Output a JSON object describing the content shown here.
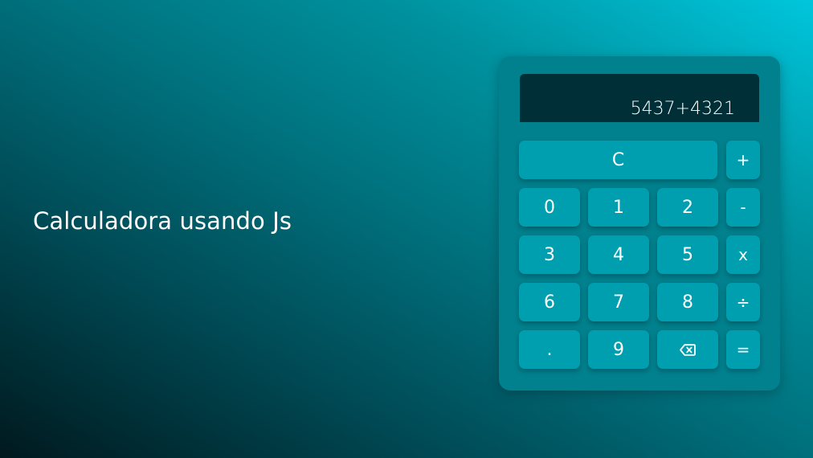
{
  "page": {
    "title": "Calculadora usando Js"
  },
  "calculator": {
    "display": "5437+4321",
    "keys": {
      "clear": "C",
      "plus": "+",
      "minus": "-",
      "multiply": "x",
      "divide": "÷",
      "equals": "=",
      "decimal": ".",
      "digit_0": "0",
      "digit_1": "1",
      "digit_2": "2",
      "digit_3": "3",
      "digit_4": "4",
      "digit_5": "5",
      "digit_6": "6",
      "digit_7": "7",
      "digit_8": "8",
      "digit_9": "9",
      "backspace_icon": "backspace-icon"
    }
  },
  "colors": {
    "calculator_body": "#00818d",
    "display_background": "#002f37",
    "key_background": "#009fb0",
    "text": "#ffffff"
  }
}
